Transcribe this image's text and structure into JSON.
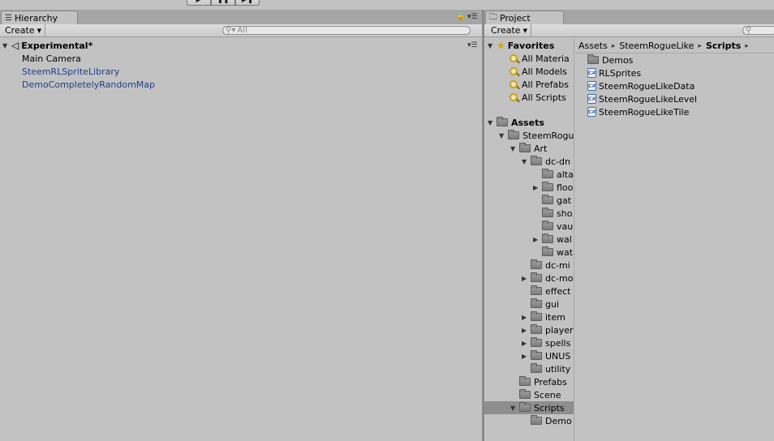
{
  "playbar": {
    "play_icon": "play-icon",
    "pause_icon": "pause-icon",
    "step_icon": "step-icon"
  },
  "hierarchy": {
    "tab_label": "Hierarchy",
    "create_label": "Create",
    "search_placeholder": "All",
    "scene_name": "Experimental*",
    "items": [
      {
        "label": "Main Camera",
        "color": "#000000"
      },
      {
        "label": "SteemRLSpriteLibrary",
        "color": "#1e3f8a"
      },
      {
        "label": "DemoCompletelyRandomMap",
        "color": "#1e3f8a"
      }
    ]
  },
  "project": {
    "tab_label": "Project",
    "create_label": "Create",
    "favorites": {
      "label": "Favorites",
      "items": [
        "All Materia",
        "All Models",
        "All Prefabs",
        "All Scripts"
      ]
    },
    "tree": [
      {
        "label": "Assets",
        "depth": 0,
        "expand": "open",
        "bold": true
      },
      {
        "label": "SteemRogu",
        "depth": 1,
        "expand": "open"
      },
      {
        "label": "Art",
        "depth": 2,
        "expand": "open"
      },
      {
        "label": "dc-dn",
        "depth": 3,
        "expand": "open"
      },
      {
        "label": "alta",
        "depth": 4,
        "expand": "none"
      },
      {
        "label": "floo",
        "depth": 4,
        "expand": "closed"
      },
      {
        "label": "gat",
        "depth": 4,
        "expand": "none"
      },
      {
        "label": "sho",
        "depth": 4,
        "expand": "none"
      },
      {
        "label": "vau",
        "depth": 4,
        "expand": "none"
      },
      {
        "label": "wal",
        "depth": 4,
        "expand": "closed"
      },
      {
        "label": "wat",
        "depth": 4,
        "expand": "none"
      },
      {
        "label": "dc-mi",
        "depth": 3,
        "expand": "none"
      },
      {
        "label": "dc-mo",
        "depth": 3,
        "expand": "closed"
      },
      {
        "label": "effect",
        "depth": 3,
        "expand": "none"
      },
      {
        "label": "gui",
        "depth": 3,
        "expand": "none"
      },
      {
        "label": "item",
        "depth": 3,
        "expand": "closed"
      },
      {
        "label": "player",
        "depth": 3,
        "expand": "closed"
      },
      {
        "label": "spells",
        "depth": 3,
        "expand": "closed"
      },
      {
        "label": "UNUS",
        "depth": 3,
        "expand": "closed"
      },
      {
        "label": "utility",
        "depth": 3,
        "expand": "none"
      },
      {
        "label": "Prefabs",
        "depth": 2,
        "expand": "none"
      },
      {
        "label": "Scene",
        "depth": 2,
        "expand": "none"
      },
      {
        "label": "Scripts",
        "depth": 2,
        "expand": "open",
        "selected": true
      },
      {
        "label": "Demo",
        "depth": 3,
        "expand": "none"
      }
    ],
    "breadcrumb": [
      "Assets",
      "SteemRogueLike",
      "Scripts"
    ],
    "files": [
      {
        "label": "Demos",
        "kind": "folder"
      },
      {
        "label": "RLSprites",
        "kind": "script"
      },
      {
        "label": "SteemRogueLikeData",
        "kind": "script"
      },
      {
        "label": "SteemRogueLikeLevel",
        "kind": "script"
      },
      {
        "label": "SteemRogueLikeTile",
        "kind": "script"
      }
    ]
  }
}
